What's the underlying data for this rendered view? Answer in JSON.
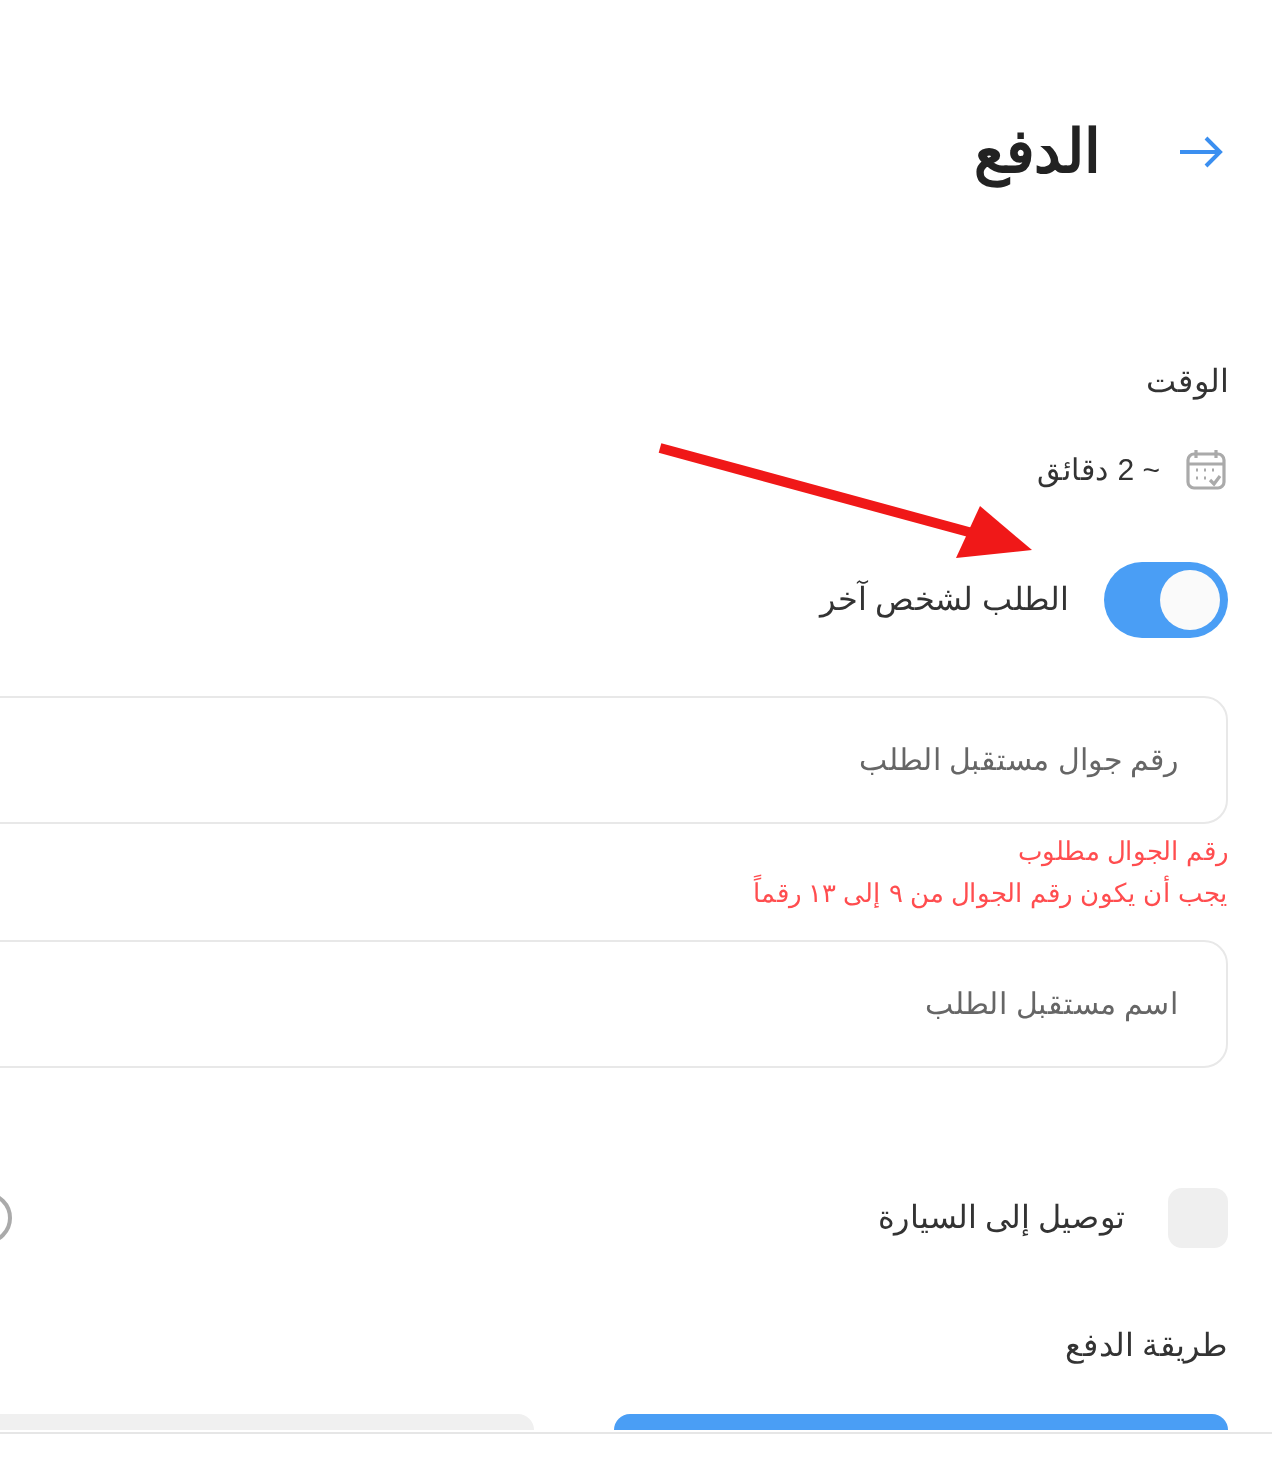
{
  "header": {
    "title": "الدفع"
  },
  "time": {
    "label": "الوقت",
    "value": "~ 2 دقائق"
  },
  "order_for_other": {
    "label": "الطلب لشخص آخر",
    "on": true
  },
  "fields": [
    {
      "placeholder": "رقم جوال مستقبل الطلب",
      "errors": [
        "رقم الجوال مطلوب",
        "يجب أن يكون رقم الجوال من ٩ إلى ١٣ رقماً"
      ]
    },
    {
      "placeholder": "اسم مستقبل الطلب"
    }
  ],
  "car_delivery": {
    "label": "توصيل إلى السيارة",
    "checked": false
  },
  "payment": {
    "title": "طريقة الدفع",
    "options": [
      {
        "selected": true
      },
      {
        "selected": false
      }
    ]
  }
}
